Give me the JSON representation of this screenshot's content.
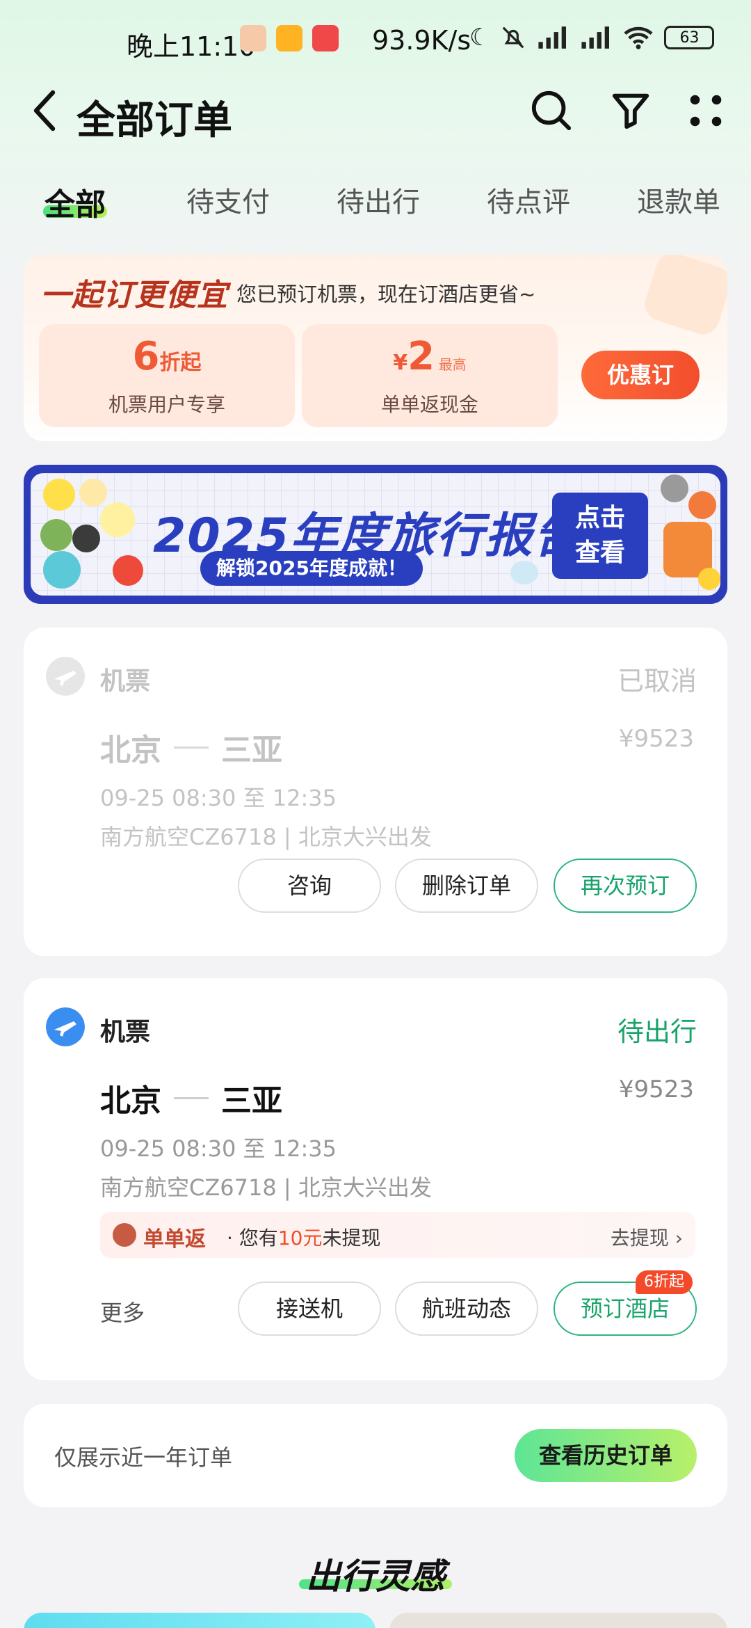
{
  "status_bar": {
    "time": "晚上11:10",
    "network_speed": "93.9K/s",
    "battery": "63"
  },
  "header": {
    "title": "全部订单"
  },
  "tabs": [
    {
      "label": "全部",
      "active": true
    },
    {
      "label": "待支付",
      "active": false
    },
    {
      "label": "待出行",
      "active": false
    },
    {
      "label": "待点评",
      "active": false
    },
    {
      "label": "退款单",
      "active": false
    }
  ],
  "promo": {
    "slogan": "一起订更便宜",
    "description": "您已预订机票，现在订酒店更省~",
    "box1": {
      "value": "6",
      "unit": "折起",
      "sub": "机票用户专享"
    },
    "box2": {
      "currency": "¥",
      "value": "2",
      "unit": "最高",
      "sub": "单单返现金"
    },
    "button": "优惠订"
  },
  "banner": {
    "title": "2025年度旅行报告",
    "pill": "解锁2025年度成就！",
    "cta_line1": "点击",
    "cta_line2": "查看"
  },
  "orders": [
    {
      "category": "机票",
      "status": "已取消",
      "from": "北京",
      "to": "三亚",
      "price": "¥9523",
      "time": "09-25 08:30 至 12:35",
      "detail": "南方航空CZ6718 | 北京大兴出发",
      "buttons": [
        "咨询",
        "删除订单",
        "再次预订"
      ]
    },
    {
      "category": "机票",
      "status": "待出行",
      "from": "北京",
      "to": "三亚",
      "price": "¥9523",
      "time": "09-25 08:30 至 12:35",
      "detail": "南方航空CZ6718 | 北京大兴出发",
      "refund": {
        "name": "单单返",
        "text_prefix": "· 您有",
        "amount": "10元",
        "text_suffix": "未提现",
        "link": "去提现"
      },
      "more": "更多",
      "buttons": [
        "接送机",
        "航班动态",
        "预订酒店"
      ],
      "badge": "6折起"
    }
  ],
  "history": {
    "text": "仅展示近一年订单",
    "button": "查看历史订单"
  },
  "inspiration": {
    "title": "出行灵感"
  },
  "colors": {
    "accent_green": "#17a36a",
    "promo_orange": "#f24e2d",
    "banner_blue": "#2a3fc0"
  }
}
